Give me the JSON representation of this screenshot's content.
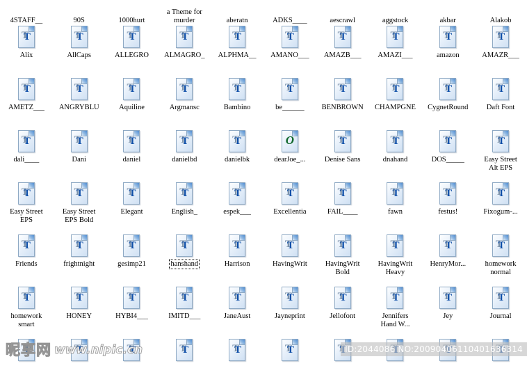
{
  "window": {
    "view_mode": "medium-icons",
    "columns": 10,
    "item_type": "font-file"
  },
  "icons": {
    "truetype_glyph_back": "T",
    "truetype_glyph_front": "T",
    "opentype_glyph": "O",
    "truetype_name": "truetype-font-icon",
    "opentype_name": "opentype-font-icon"
  },
  "colors": {
    "background": "#ffffff",
    "label_text": "#000000",
    "icon_page_fill": "#eaf2fb",
    "icon_page_border": "#8ea9c4",
    "icon_glyph_blue": "#0f4fa8",
    "icon_glyph_gray": "#7d93ab",
    "icon_glyph_green": "#10682c",
    "watermark_band": "#bebebe"
  },
  "watermark": {
    "logo_cn": "昵享网",
    "logo_url": "www.nipic.cn",
    "id_text": "ID:2044086 NO:20090406110401636314"
  },
  "rows": [
    {
      "partial": "labels-only",
      "items": [
        {
          "label": "4STAFF__",
          "type": "ttf"
        },
        {
          "label": "90S",
          "type": "ttf"
        },
        {
          "label": "1000hurt",
          "type": "ttf"
        },
        {
          "label": "a Theme for\nmurder",
          "type": "ttf"
        },
        {
          "label": "aberatn",
          "type": "ttf"
        },
        {
          "label": "ADKS____",
          "type": "ttf"
        },
        {
          "label": "aescrawl",
          "type": "ttf"
        },
        {
          "label": "aggstock",
          "type": "ttf"
        },
        {
          "label": "akbar",
          "type": "ttf"
        },
        {
          "label": "Alakob",
          "type": "ttf"
        }
      ]
    },
    {
      "partial": "none",
      "items": [
        {
          "label": "Alix",
          "type": "ttf"
        },
        {
          "label": "AllCaps",
          "type": "ttf"
        },
        {
          "label": "ALLEGRO",
          "type": "ttf"
        },
        {
          "label": "ALMAGRO_",
          "type": "ttf"
        },
        {
          "label": "ALPHMA__",
          "type": "ttf"
        },
        {
          "label": "AMANO___",
          "type": "ttf"
        },
        {
          "label": "AMAZB___",
          "type": "ttf"
        },
        {
          "label": "AMAZI___",
          "type": "ttf"
        },
        {
          "label": "amazon",
          "type": "ttf"
        },
        {
          "label": "AMAZR___",
          "type": "ttf"
        }
      ]
    },
    {
      "partial": "none",
      "items": [
        {
          "label": "AMETZ___",
          "type": "ttf"
        },
        {
          "label": "ANGRYBLU",
          "type": "ttf"
        },
        {
          "label": "Aquiline",
          "type": "ttf"
        },
        {
          "label": "Argmansc",
          "type": "ttf"
        },
        {
          "label": "Bambino",
          "type": "ttf"
        },
        {
          "label": "be______",
          "type": "ttf"
        },
        {
          "label": "BENBROWN",
          "type": "ttf"
        },
        {
          "label": "CHAMPGNE",
          "type": "ttf"
        },
        {
          "label": "CygnetRound",
          "type": "ttf"
        },
        {
          "label": "Daft Font",
          "type": "ttf"
        }
      ]
    },
    {
      "partial": "none",
      "items": [
        {
          "label": "dali____",
          "type": "ttf"
        },
        {
          "label": "Dani",
          "type": "ttf"
        },
        {
          "label": "daniel",
          "type": "ttf"
        },
        {
          "label": "danielbd",
          "type": "ttf"
        },
        {
          "label": "danielbk",
          "type": "ttf"
        },
        {
          "label": "dearJoe_...",
          "type": "otf"
        },
        {
          "label": "Denise Sans",
          "type": "ttf"
        },
        {
          "label": "dnahand",
          "type": "ttf"
        },
        {
          "label": "DOS_____",
          "type": "ttf"
        },
        {
          "label": "Easy Street\nAlt EPS",
          "type": "ttf"
        }
      ]
    },
    {
      "partial": "none",
      "items": [
        {
          "label": "Easy Street\nEPS",
          "type": "ttf"
        },
        {
          "label": "Easy Street\nEPS Bold",
          "type": "ttf"
        },
        {
          "label": "Elegant",
          "type": "ttf"
        },
        {
          "label": "English_",
          "type": "ttf"
        },
        {
          "label": "espek___",
          "type": "ttf"
        },
        {
          "label": "Excellentia",
          "type": "ttf"
        },
        {
          "label": "FAIL____",
          "type": "ttf"
        },
        {
          "label": "fawn",
          "type": "ttf"
        },
        {
          "label": "festus!",
          "type": "ttf"
        },
        {
          "label": "Fixogum-...",
          "type": "ttf"
        }
      ]
    },
    {
      "partial": "none",
      "items": [
        {
          "label": "Friends",
          "type": "ttf"
        },
        {
          "label": "frightnight",
          "type": "ttf"
        },
        {
          "label": "gesimp21",
          "type": "ttf"
        },
        {
          "label": "hanshand",
          "type": "ttf",
          "selected": true
        },
        {
          "label": "Harrison",
          "type": "ttf"
        },
        {
          "label": "HavingWrit",
          "type": "ttf"
        },
        {
          "label": "HavingWrit\nBold",
          "type": "ttf"
        },
        {
          "label": "HavingWrit\nHeavy",
          "type": "ttf"
        },
        {
          "label": "HenryMor...",
          "type": "ttf"
        },
        {
          "label": "homework\nnormal",
          "type": "ttf"
        }
      ]
    },
    {
      "partial": "none",
      "items": [
        {
          "label": "homework\nsmart",
          "type": "ttf"
        },
        {
          "label": "HONEY",
          "type": "ttf"
        },
        {
          "label": "HYBI4___",
          "type": "ttf"
        },
        {
          "label": "IMITD___",
          "type": "ttf"
        },
        {
          "label": "JaneAust",
          "type": "ttf"
        },
        {
          "label": "Jayneprint",
          "type": "ttf"
        },
        {
          "label": "Jellofont",
          "type": "ttf"
        },
        {
          "label": "Jennifers\nHand W...",
          "type": "ttf"
        },
        {
          "label": "Jey",
          "type": "ttf"
        },
        {
          "label": "Journal",
          "type": "ttf"
        }
      ]
    },
    {
      "partial": "icons-only",
      "items": [
        {
          "label": "",
          "type": "ttf"
        },
        {
          "label": "",
          "type": "ttf"
        },
        {
          "label": "",
          "type": "ttf"
        },
        {
          "label": "",
          "type": "ttf"
        },
        {
          "label": "",
          "type": "ttf"
        },
        {
          "label": "",
          "type": "ttf"
        },
        {
          "label": "",
          "type": "ttf"
        },
        {
          "label": "",
          "type": "ttf"
        },
        {
          "label": "",
          "type": "ttf"
        },
        {
          "label": "",
          "type": "ttf"
        }
      ]
    }
  ]
}
